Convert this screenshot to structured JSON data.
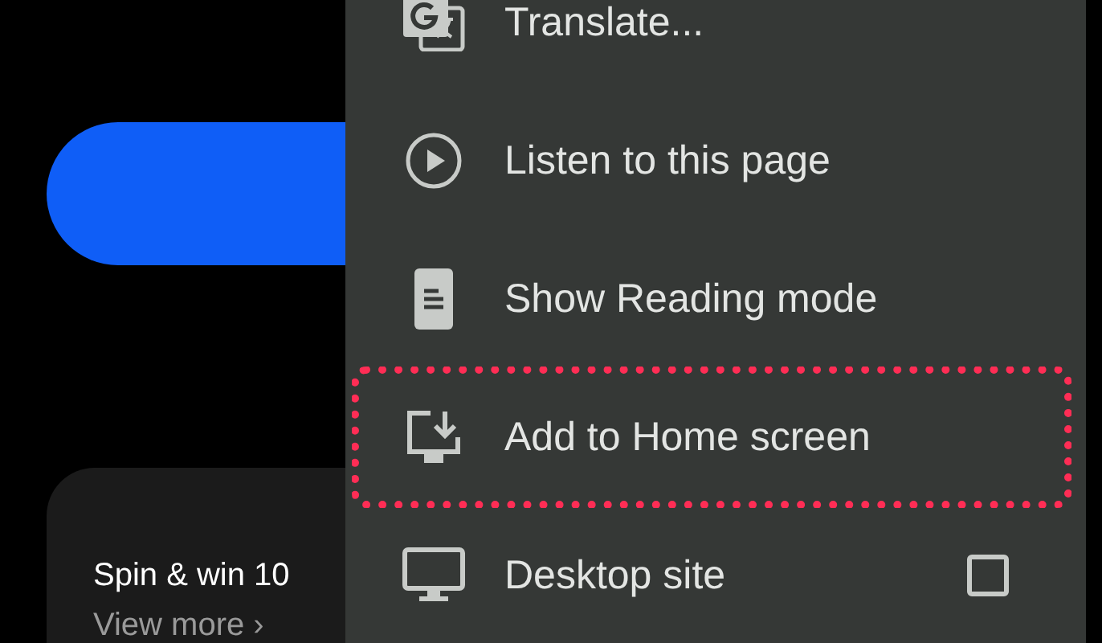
{
  "page": {
    "promo_card": {
      "title": "Spin & win 10",
      "link": "View more ›"
    }
  },
  "menu": {
    "items": [
      {
        "kind": "translate",
        "label": "Translate...",
        "highlighted": false
      },
      {
        "kind": "listen",
        "label": "Listen to this page",
        "highlighted": false
      },
      {
        "kind": "reading",
        "label": "Show Reading mode",
        "highlighted": false
      },
      {
        "kind": "install",
        "label": "Add to Home screen",
        "highlighted": true
      },
      {
        "kind": "desktop",
        "label": "Desktop site",
        "highlighted": false,
        "checked": false
      }
    ]
  }
}
